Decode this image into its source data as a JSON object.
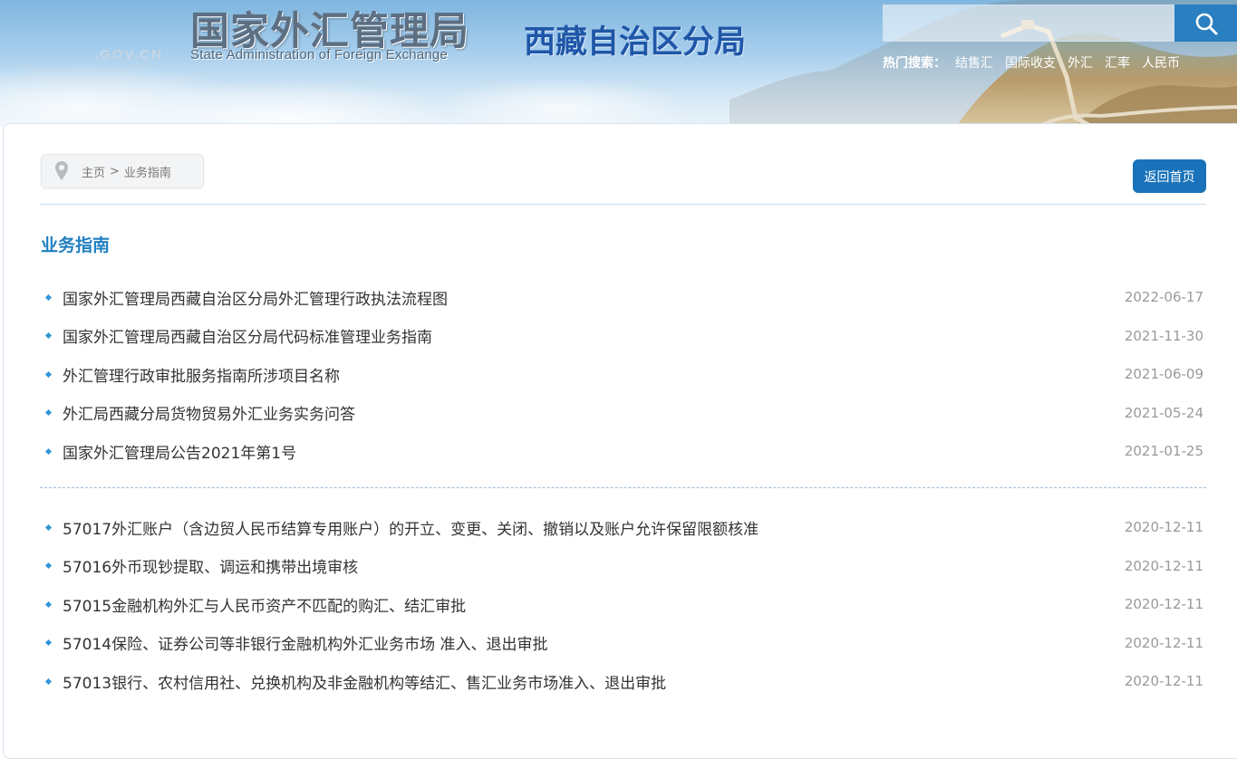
{
  "header": {
    "logo_cn": "国家外汇管理局",
    "logo_gov": ".GOV.CN",
    "logo_en": "State Administration of Foreign Exchange",
    "branch_name": "西藏自治区分局",
    "search": {
      "value": ""
    },
    "hot_search": {
      "label": "热门搜索：",
      "items": [
        "结售汇",
        "国际收支",
        "外汇",
        "汇率",
        "人民币"
      ]
    }
  },
  "breadcrumb": {
    "home": "主页",
    "separator": ">",
    "current": "业务指南"
  },
  "home_button": "返回首页",
  "section_title": "业务指南",
  "list_group_1": [
    {
      "title": "国家外汇管理局西藏自治区分局外汇管理行政执法流程图",
      "date": "2022-06-17"
    },
    {
      "title": "国家外汇管理局西藏自治区分局代码标准管理业务指南",
      "date": "2021-11-30"
    },
    {
      "title": "外汇管理行政审批服务指南所涉项目名称",
      "date": "2021-06-09"
    },
    {
      "title": "外汇局西藏分局货物贸易外汇业务实务问答",
      "date": "2021-05-24"
    },
    {
      "title": "国家外汇管理局公告2021年第1号",
      "date": "2021-01-25"
    }
  ],
  "list_group_2": [
    {
      "title": "57017外汇账户（含边贸人民币结算专用账户）的开立、变更、关闭、撤销以及账户允许保留限额核准",
      "date": "2020-12-11"
    },
    {
      "title": "57016外币现钞提取、调运和携带出境审核",
      "date": "2020-12-11"
    },
    {
      "title": "57015金融机构外汇与人民币资产不匹配的购汇、结汇审批",
      "date": "2020-12-11"
    },
    {
      "title": "57014保险、证券公司等非银行金融机构外汇业务市场 准入、退出审批",
      "date": "2020-12-11"
    },
    {
      "title": "57013银行、农村信用社、兑换机构及非金融机构等结汇、售汇业务市场准入、退出审批",
      "date": "2020-12-11"
    }
  ],
  "colors": {
    "accent": "#1f7fc1",
    "button": "#1a73ba",
    "bullet": "#2f95d8",
    "branch_title": "#1f56a8"
  }
}
